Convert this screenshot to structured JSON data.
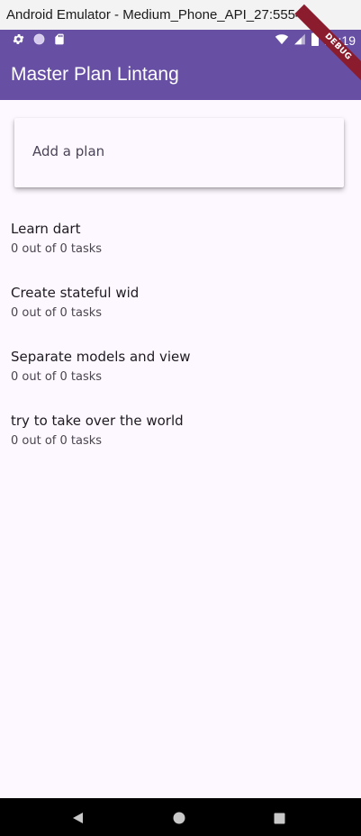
{
  "window": {
    "title": "Android Emulator - Medium_Phone_API_27:5554"
  },
  "status_bar": {
    "time": "10:19",
    "left_icons": [
      "gear-icon",
      "circle-icon",
      "sd-card-icon"
    ],
    "right_icons": [
      "wifi-icon",
      "signal-icon",
      "battery-icon"
    ]
  },
  "app_bar": {
    "title": "Master Plan Lintang",
    "debug_banner": "DEBUG"
  },
  "plan_input": {
    "placeholder": "Add a plan"
  },
  "plans": [
    {
      "name": "Learn dart",
      "progress": "0 out of 0 tasks"
    },
    {
      "name": "Create stateful wid",
      "progress": "0 out of 0 tasks"
    },
    {
      "name": "Separate models and view",
      "progress": "0 out of 0 tasks"
    },
    {
      "name": "try to take over the world",
      "progress": "0 out of 0 tasks"
    }
  ],
  "nav_bar": {
    "buttons": [
      "back-icon",
      "home-icon",
      "recents-icon"
    ]
  },
  "colors": {
    "primary": "#6750a4",
    "background": "#fdf7ff",
    "text": "#1d1b20",
    "subtext": "#49454f"
  }
}
